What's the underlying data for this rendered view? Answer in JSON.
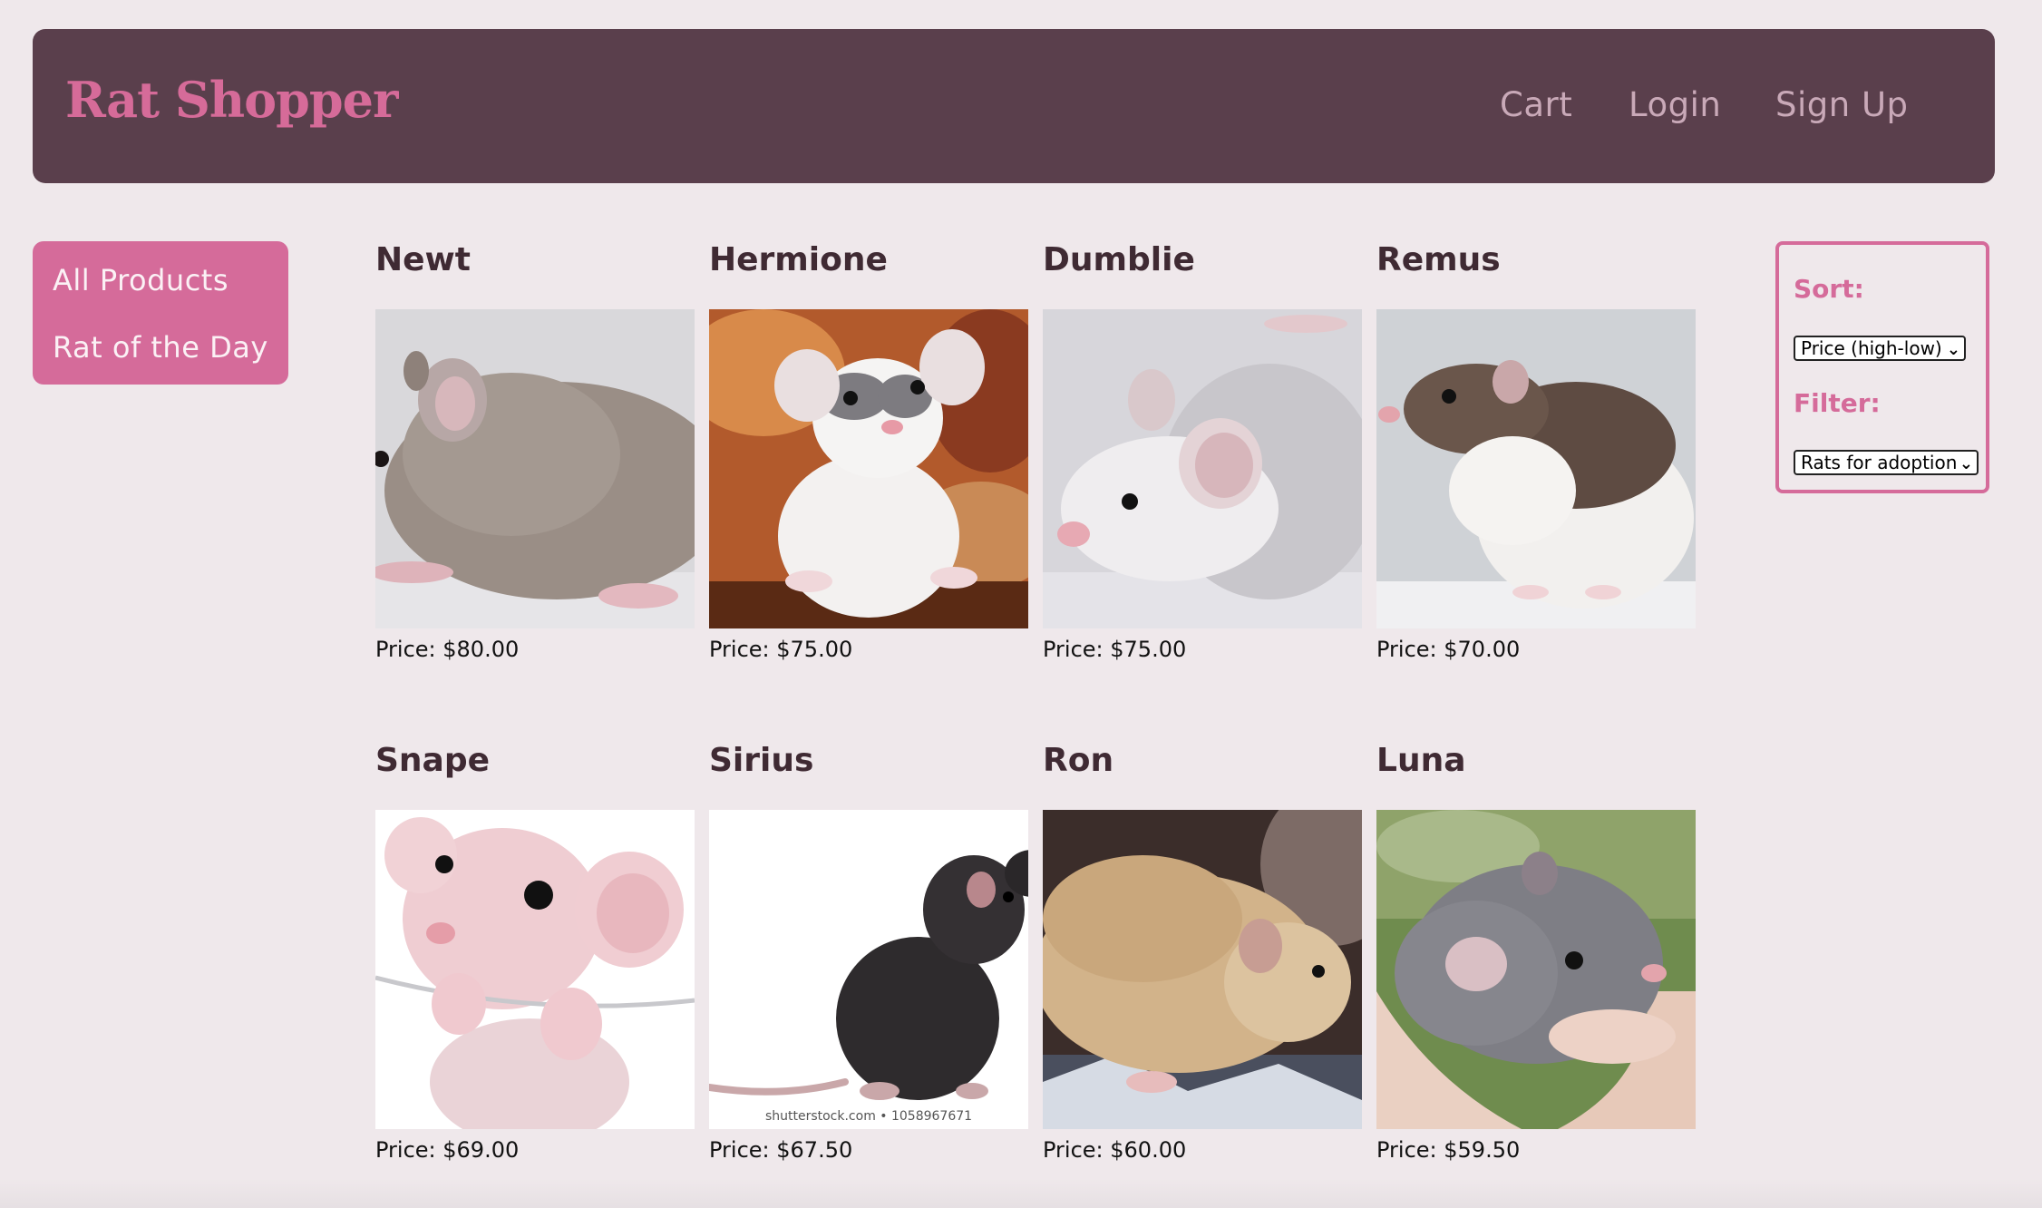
{
  "brand": "Rat Shopper",
  "nav": {
    "cart": "Cart",
    "login": "Login",
    "signup": "Sign Up"
  },
  "sidebar": {
    "items": [
      {
        "label": "All Products"
      },
      {
        "label": "Rat of the Day"
      }
    ]
  },
  "products": [
    {
      "name": "Newt",
      "price": "Price: $80.00"
    },
    {
      "name": "Hermione",
      "price": "Price: $75.00"
    },
    {
      "name": "Dumblie",
      "price": "Price: $75.00"
    },
    {
      "name": "Remus",
      "price": "Price: $70.00"
    },
    {
      "name": "Snape",
      "price": "Price: $69.00"
    },
    {
      "name": "Sirius",
      "price": "Price: $67.50",
      "watermark": "shutterstock.com • 1058967671"
    },
    {
      "name": "Ron",
      "price": "Price: $60.00"
    },
    {
      "name": "Luna",
      "price": "Price: $59.50"
    }
  ],
  "controls": {
    "sort_label": "Sort:",
    "sort_value": "Price (high-low)",
    "filter_label": "Filter:",
    "filter_value": "Rats for adoption"
  },
  "colors": {
    "background": "#efe8eb",
    "header": "#5a3f4c",
    "accent": "#d56b9a",
    "nav_text": "#c9a9b8"
  }
}
